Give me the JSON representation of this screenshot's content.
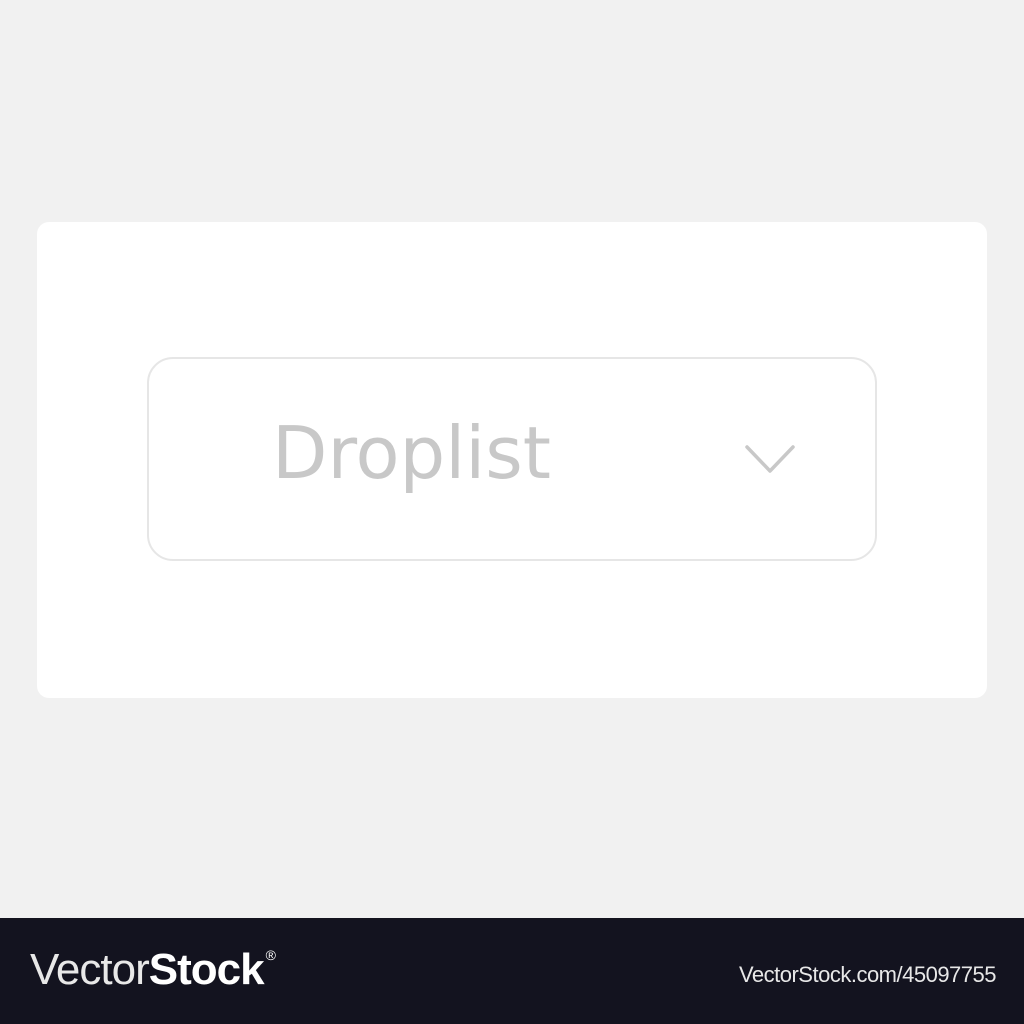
{
  "dropdown": {
    "label": "Droplist",
    "label_color": "#c8c8c8",
    "border_color": "#e6e6e6",
    "icon": "chevron-down-icon"
  },
  "colors": {
    "page_background": "#f1f1f1",
    "card_background": "#ffffff",
    "watermark_bar": "#13131f"
  },
  "watermark": {
    "logo_light": "Vector",
    "logo_bold": "Stock",
    "logo_mark": "®",
    "url": "VectorStock.com/45097755"
  }
}
